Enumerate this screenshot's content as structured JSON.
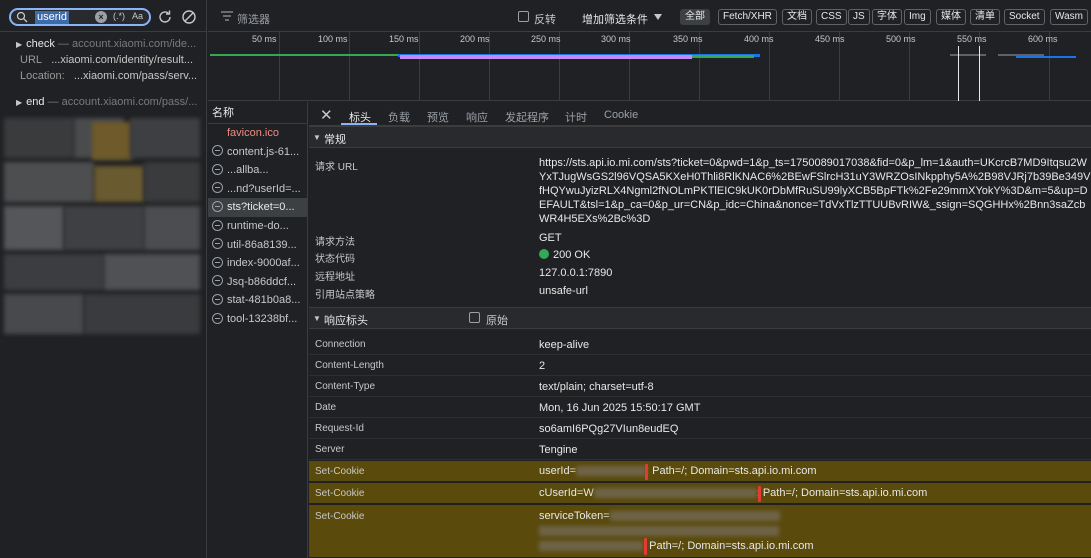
{
  "search": {
    "query": "userid",
    "regex_label": "(.*)",
    "case_label": "Aa",
    "results": [
      {
        "name": "check",
        "url": "account.xiaomi.com/ide...",
        "lines": [
          {
            "key": "URL",
            "value": "...xiaomi.com/identity/result..."
          },
          {
            "key": "Location:",
            "value": "...xiaomi.com/pass/serv..."
          }
        ]
      },
      {
        "name": "end",
        "url": "account.xiaomi.com/pass/..."
      }
    ]
  },
  "toolbar": {
    "filter_placeholder": "筛选器",
    "invert_label": "反转",
    "more_filters_label": "增加筛选条件",
    "types": [
      "全部",
      "Fetch/XHR",
      "文档",
      "CSS",
      "JS",
      "字体",
      "Img",
      "媒体",
      "清单",
      "Socket",
      "Wasm"
    ],
    "active_type": "全部"
  },
  "timeline": {
    "ticks": [
      "50 ms",
      "100 ms",
      "150 ms",
      "200 ms",
      "250 ms",
      "300 ms",
      "350 ms",
      "400 ms",
      "450 ms",
      "500 ms",
      "550 ms",
      "600 ms"
    ]
  },
  "request_list": {
    "header": "名称",
    "items": [
      "favicon.ico",
      "content.js-61...",
      "...allba...",
      "...nd?userId=...",
      "sts?ticket=0...",
      "runtime-do...",
      "util-86a8139...",
      "index-9000af...",
      "Jsq-b86ddcf...",
      "stat-481b0a8...",
      "tool-13238bf..."
    ],
    "selected_index": 4
  },
  "details": {
    "tabs": [
      "标头",
      "负载",
      "预览",
      "响应",
      "发起程序",
      "计时",
      "Cookie"
    ],
    "active_tab": "标头",
    "general": {
      "title": "常规",
      "request_url_label": "请求 URL",
      "request_url": "https://sts.api.io.mi.com/sts?ticket=0&pwd=1&p_ts=1750089017038&fid=0&p_lm=1&auth=UKcrcB7MD9Itqsu2WYxTJugWsGS2l96VQSA5KXeH0Thli8RlKNAC6%2BEwFSlrcH31uY3WRZOsINkpphy5A%2B98VJRj7b39Be349VfHQYwuJyizRLX4Ngml2fNOLmPKTlEIC9kUK0rDbMfRuSU99lyXCB5BpFTk%2Fe29mmXYokY%3D&m=5&up=DEFAULT&tsl=1&p_ca=0&p_ur=CN&p_idc=China&nonce=TdVxTlzTTUUBvRIW&_ssign=SQGHHx%2Bnn3saZcbWR4H5EXs%2Bc%3D",
      "method_label": "请求方法",
      "method": "GET",
      "status_label": "状态代码",
      "status": "200 OK",
      "remote_label": "远程地址",
      "remote": "127.0.0.1:7890",
      "referrer_label": "引用站点策略",
      "referrer": "unsafe-url"
    },
    "response_headers": {
      "title": "响应标头",
      "raw_label": "原始",
      "rows": [
        {
          "key": "Connection",
          "value": "keep-alive"
        },
        {
          "key": "Content-Length",
          "value": "2"
        },
        {
          "key": "Content-Type",
          "value": "text/plain; charset=utf-8"
        },
        {
          "key": "Date",
          "value": "Mon, 16 Jun 2025 15:50:17 GMT"
        },
        {
          "key": "Request-Id",
          "value": "so6amI6PQg27VIun8eudEQ"
        },
        {
          "key": "Server",
          "value": "Tengine"
        }
      ],
      "cookies": [
        {
          "key": "Set-Cookie",
          "prefix": "userId=",
          "suffix": "; Path=/; Domain=sts.api.io.mi.com"
        },
        {
          "key": "Set-Cookie",
          "prefix": "cUserId=W",
          "suffix": "; Path=/; Domain=sts.api.io.mi.com"
        },
        {
          "key": "Set-Cookie",
          "prefix": "serviceToken=",
          "suffix": "; Path=/; Domain=sts.api.io.mi.com"
        }
      ]
    }
  }
}
